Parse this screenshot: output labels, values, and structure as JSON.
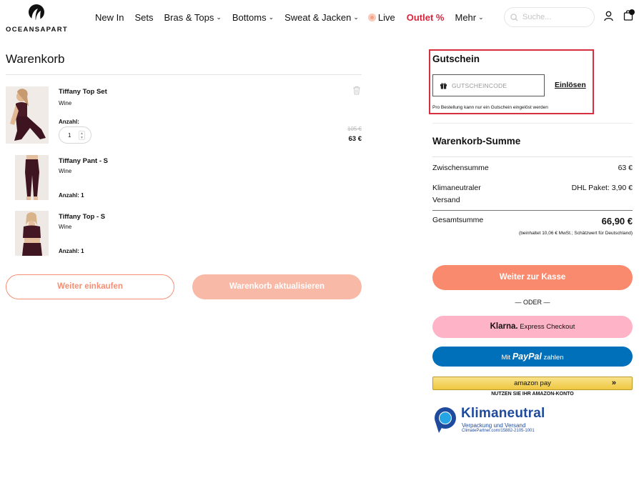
{
  "brand": {
    "name": "OCEANSAPART"
  },
  "nav": {
    "items": [
      {
        "label": "New In",
        "dropdown": false
      },
      {
        "label": "Sets",
        "dropdown": false
      },
      {
        "label": "Bras & Tops",
        "dropdown": true
      },
      {
        "label": "Bottoms",
        "dropdown": true
      },
      {
        "label": "Sweat & Jacken",
        "dropdown": true
      },
      {
        "label": "Live",
        "dropdown": false
      },
      {
        "label": "Outlet %",
        "dropdown": false
      },
      {
        "label": "Mehr",
        "dropdown": true
      }
    ],
    "search_placeholder": "Suche...",
    "cart_count": ""
  },
  "cart": {
    "title": "Warenkorb",
    "items": [
      {
        "name": "Tiffany Top Set",
        "variant": "Wine",
        "qty_label": "Anzahl:",
        "qty": "1",
        "old_price": "105 €",
        "price": "63 €"
      },
      {
        "name": "Tiffany Pant - S",
        "variant": "Wine",
        "qty_label": "Anzahl: 1"
      },
      {
        "name": "Tiffany Top - S",
        "variant": "Wine",
        "qty_label": "Anzahl: 1"
      }
    ],
    "continue_label": "Weiter einkaufen",
    "update_label": "Warenkorb aktualisieren"
  },
  "coupon": {
    "title": "Gutschein",
    "placeholder": "GUTSCHEINCODE",
    "redeem_label": "Einlösen",
    "note": "Pro Bestellung kann nur ein Gutschein eingelöst werden"
  },
  "totals": {
    "title": "Warenkorb-Summe",
    "subtotal_label": "Zwischensumme",
    "subtotal_value": "63 €",
    "shipping_label": "Klimaneutraler Versand",
    "shipping_value": "DHL Paket: 3,90 €",
    "total_label": "Gesamtsumme",
    "total_value": "66,90 €",
    "tax_note": "(beinhaltet 10,06 € MwSt.; Schätzwert für Deutschland)"
  },
  "checkout": {
    "checkout_label": "Weiter zur Kasse",
    "or_label": "— ODER —",
    "klarna_brand": "Klarna.",
    "klarna_label": "Express Checkout",
    "paypal_prefix": "Mit",
    "paypal_brand": "PayPal",
    "paypal_suffix": "zahlen",
    "amazon_label": "amazon pay",
    "amazon_note": "NUTZEN SIE IHR AMAZON-KONTO"
  },
  "climate": {
    "title": "Klimaneutral",
    "subtitle": "Verpackung und Versand",
    "id": "ClimatePartner.com/15882-2105-1001"
  },
  "colors": {
    "accent": "#f98a6d",
    "outlet": "#d7263d",
    "highlight": "#d62f3f",
    "klarna": "#ffb3c7",
    "paypal": "#0070ba",
    "climate": "#1e4b9e"
  }
}
